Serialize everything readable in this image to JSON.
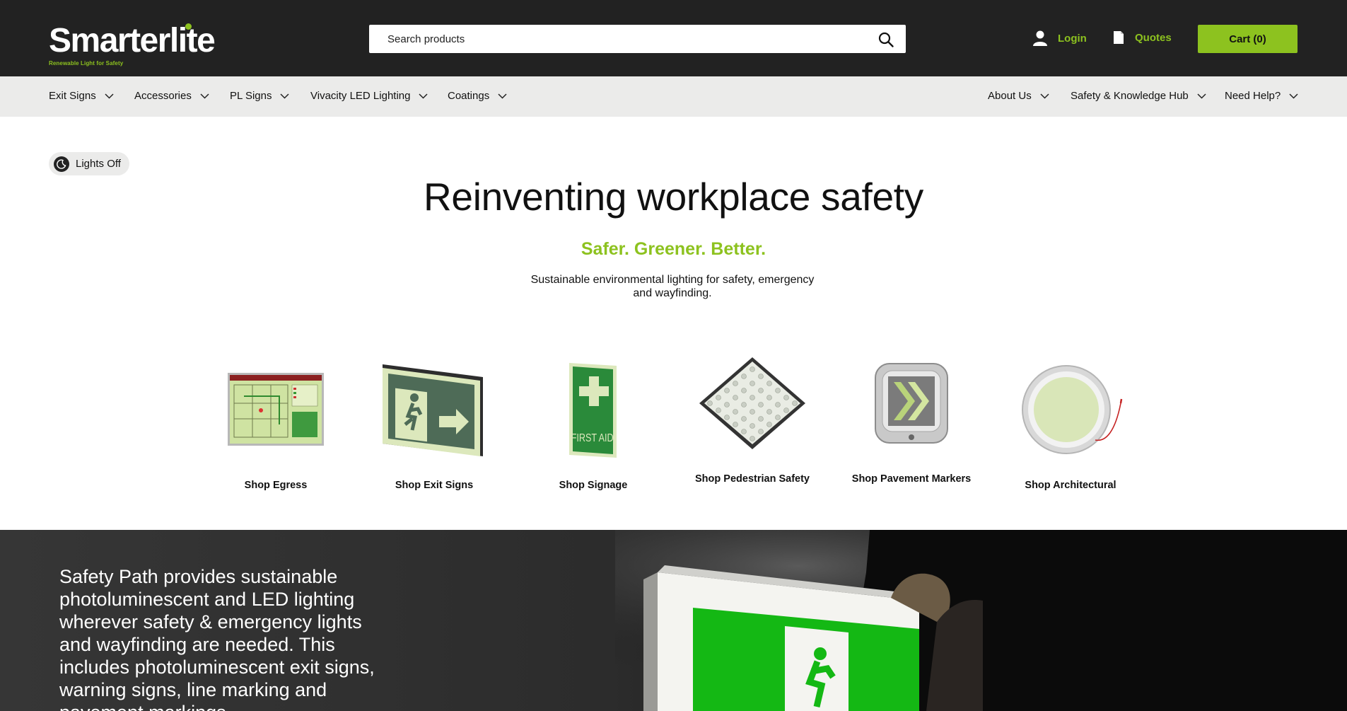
{
  "header": {
    "logo_text": "Smarterlite",
    "logo_tagline": "Renewable Light for Safety",
    "search_placeholder": "Search products",
    "login_label": "Login",
    "quotes_label": "Quotes",
    "cart_label": "Cart (0)"
  },
  "nav": {
    "left": [
      "Exit Signs",
      "Accessories",
      "PL Signs",
      "Vivacity LED Lighting",
      "Coatings"
    ],
    "right": [
      "About Us",
      "Safety & Knowledge Hub",
      "Need Help?"
    ]
  },
  "toggle": {
    "label": "Lights Off"
  },
  "hero": {
    "title": "Reinventing workplace safety",
    "subtitle": "Safer. Greener. Better.",
    "description": "Sustainable environmental lighting for safety, emergency and wayfinding."
  },
  "categories": [
    {
      "label": "Shop Egress",
      "icon": "egress-map-image"
    },
    {
      "label": "Shop Exit Signs",
      "icon": "exit-sign-image"
    },
    {
      "label": "Shop Signage",
      "icon": "first-aid-sign-image"
    },
    {
      "label": "Shop Pedestrian Safety",
      "icon": "pedestrian-panel-image"
    },
    {
      "label": "Shop Pavement Markers",
      "icon": "pavement-marker-image"
    },
    {
      "label": "Shop Architectural",
      "icon": "architectural-light-image"
    }
  ],
  "first_aid_text": "FIRST AID",
  "banner": {
    "text": "Safety Path provides sustainable photoluminescent and LED lighting wherever safety & emergency lights and wayfinding are needed. This includes photoluminescent exit signs, warning signs, line marking and pavement markings."
  },
  "colors": {
    "accent": "#8dc21f",
    "header_bg": "#222222",
    "nav_bg": "#ebebea"
  }
}
